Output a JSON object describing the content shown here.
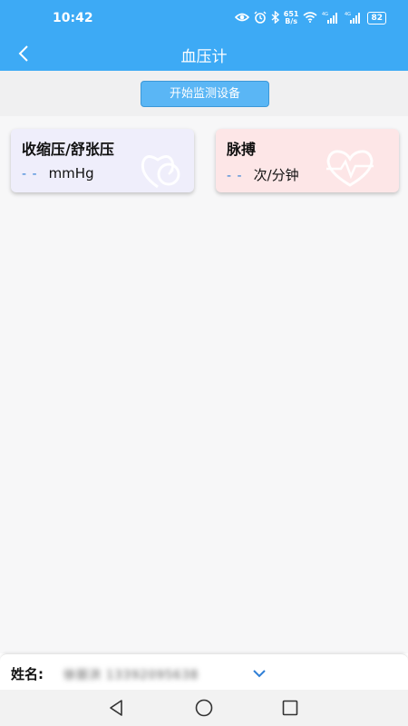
{
  "status_bar": {
    "time": "10:42",
    "net_speed_top": "651",
    "net_speed_bottom": "B/s",
    "signal1_label": "4G",
    "signal2_label": "4G",
    "battery": "82"
  },
  "nav": {
    "title": "血压计"
  },
  "toolbar": {
    "start_label": "开始监测设备"
  },
  "cards": {
    "blood_pressure": {
      "title": "收缩压/舒张压",
      "value": "- -",
      "unit": "mmHg"
    },
    "pulse": {
      "title": "脉搏",
      "value": "- -",
      "unit": "次/分钟"
    }
  },
  "footer": {
    "name_label": "姓名:",
    "name_value": "徐丽洪 13392095638"
  },
  "colors": {
    "header_blue": "#3daaf5",
    "button_blue": "#5ab6f5",
    "value_blue": "#2f7fd6",
    "bp_card_bg": "#efeefb",
    "pulse_card_bg": "#fde6e7"
  }
}
